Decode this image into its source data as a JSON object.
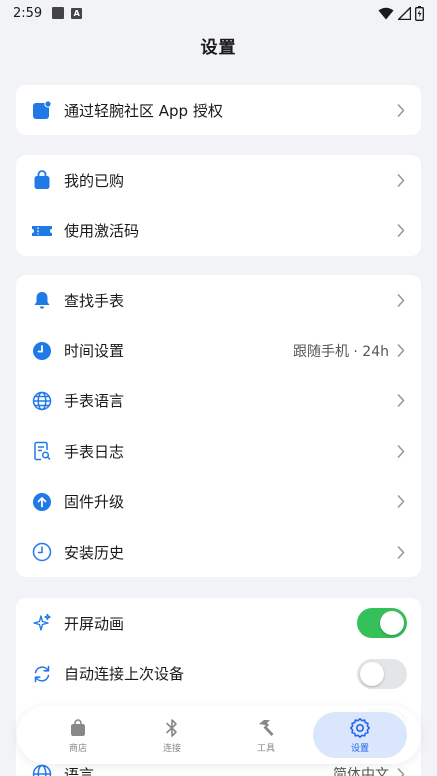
{
  "status_bar": {
    "time": "2:59",
    "notif_badge": "A"
  },
  "header": {
    "title": "设置"
  },
  "group1": {
    "items": [
      {
        "label": "通过轻腕社区 App 授权",
        "icon": "app-badge-icon"
      }
    ]
  },
  "group2": {
    "items": [
      {
        "label": "我的已购",
        "icon": "shopping-bag-icon"
      },
      {
        "label": "使用激活码",
        "icon": "ticket-icon"
      }
    ]
  },
  "group3": {
    "items": [
      {
        "label": "查找手表",
        "icon": "bell-icon"
      },
      {
        "label": "时间设置",
        "value": "跟随手机 · 24h",
        "icon": "clock-icon"
      },
      {
        "label": "手表语言",
        "icon": "globe-icon"
      },
      {
        "label": "手表日志",
        "icon": "log-document-icon"
      },
      {
        "label": "固件升级",
        "icon": "upgrade-arrow-icon"
      },
      {
        "label": "安装历史",
        "icon": "history-clock-icon"
      }
    ]
  },
  "group4": {
    "items": [
      {
        "label": "开屏动画",
        "toggle": true,
        "icon": "sparkle-icon"
      },
      {
        "label": "自动连接上次设备",
        "toggle": false,
        "icon": "sync-icon"
      }
    ],
    "partial": {
      "label": "语言",
      "value": "简体中文"
    }
  },
  "tabbar": {
    "tabs": [
      {
        "label": "商店",
        "icon": "store-bag-icon",
        "active": false
      },
      {
        "label": "连接",
        "icon": "bluetooth-icon",
        "active": false
      },
      {
        "label": "工具",
        "icon": "hammer-icon",
        "active": false
      },
      {
        "label": "设置",
        "icon": "gear-icon",
        "active": true
      }
    ]
  },
  "colors": {
    "accent": "#1f7ae8",
    "toggle_on": "#35c15a",
    "background": "#f2f3f6",
    "tab_active_bg": "#d9e6fb"
  }
}
